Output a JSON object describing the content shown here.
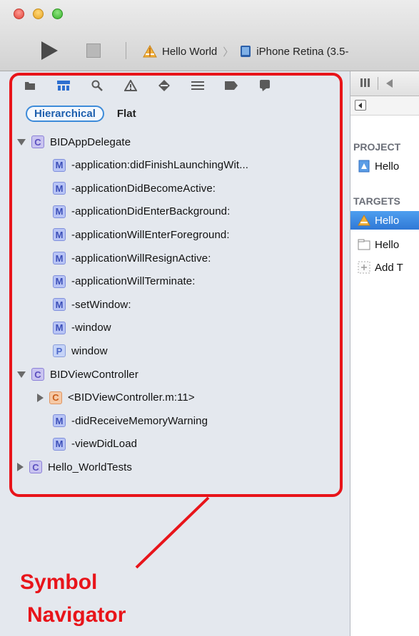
{
  "toolbar": {
    "scheme_name": "Hello World",
    "device_name": "iPhone Retina (3.5-"
  },
  "navigator": {
    "scope_options": [
      "Hierarchical",
      "Flat"
    ],
    "selected_scope": "Hierarchical",
    "tree": [
      {
        "disclosure": "expanded",
        "kind": "C",
        "label": "BIDAppDelegate",
        "level": 0
      },
      {
        "disclosure": "none",
        "kind": "M",
        "label": "-application:didFinishLaunchingWit...",
        "level": 1
      },
      {
        "disclosure": "none",
        "kind": "M",
        "label": "-applicationDidBecomeActive:",
        "level": 1
      },
      {
        "disclosure": "none",
        "kind": "M",
        "label": "-applicationDidEnterBackground:",
        "level": 1
      },
      {
        "disclosure": "none",
        "kind": "M",
        "label": "-applicationWillEnterForeground:",
        "level": 1
      },
      {
        "disclosure": "none",
        "kind": "M",
        "label": "-applicationWillResignActive:",
        "level": 1
      },
      {
        "disclosure": "none",
        "kind": "M",
        "label": "-applicationWillTerminate:",
        "level": 1
      },
      {
        "disclosure": "none",
        "kind": "M",
        "label": "-setWindow:",
        "level": 1
      },
      {
        "disclosure": "none",
        "kind": "M",
        "label": "-window",
        "level": 1
      },
      {
        "disclosure": "none",
        "kind": "P",
        "label": "window",
        "level": 1
      },
      {
        "disclosure": "expanded",
        "kind": "C",
        "label": "BIDViewController",
        "level": 0
      },
      {
        "disclosure": "collapsed",
        "kind": "Cat",
        "label": "<BIDViewController.m:11>",
        "level": 1
      },
      {
        "disclosure": "none",
        "kind": "M",
        "label": "-didReceiveMemoryWarning",
        "level": 1
      },
      {
        "disclosure": "none",
        "kind": "M",
        "label": "-viewDidLoad",
        "level": 1
      },
      {
        "disclosure": "collapsed",
        "kind": "C",
        "label": "Hello_WorldTests",
        "level": 0
      }
    ]
  },
  "annotation": {
    "line1": "Symbol",
    "line2": "Navigator",
    "color": "#e8141a"
  },
  "editor": {
    "project_header": "PROJECT",
    "project_item": "Hello",
    "targets_header": "TARGETS",
    "targets": [
      {
        "label": "Hello",
        "selected": true,
        "icon": "app-target-icon"
      },
      {
        "label": "Hello",
        "selected": false,
        "icon": "test-bundle-icon"
      },
      {
        "label": "Add T",
        "selected": false,
        "icon": "add-target-icon"
      }
    ]
  },
  "colors": {
    "selection": "#3a86e0",
    "navigator_bg": "#e4e8ee"
  }
}
